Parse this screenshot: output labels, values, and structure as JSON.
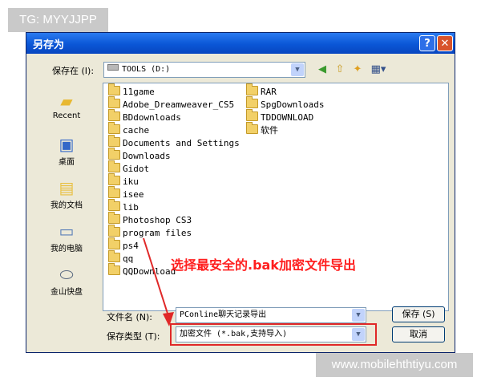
{
  "tag": "TG: MYYJJPP",
  "watermark": "www.mobilehthtiyu.com",
  "dialog": {
    "title": "另存为",
    "help": "?",
    "close": "✕",
    "save_in_label": "保存在 (I):",
    "save_in_value": "TOOLS  (D:)",
    "places": [
      "Recent",
      "桌面",
      "我的文档",
      "我的电脑",
      "金山快盘"
    ],
    "folders_col1": [
      "11game",
      "Adobe_Dreamweaver_CS5",
      "BDdownloads",
      "cache",
      "Documents and Settings",
      "Downloads",
      "Gidot",
      "iku",
      "isee",
      "lib",
      "Photoshop CS3",
      "program files",
      "ps4",
      "qq",
      "QQDownload"
    ],
    "folders_col2": [
      "RAR",
      "SpgDownloads",
      "TDDOWNLOAD",
      "软件"
    ],
    "filename_label": "文件名 (N):",
    "filename_value": "PConline聊天记录导出",
    "filetype_label": "保存类型 (T):",
    "filetype_value": "加密文件 (*.bak,支持导入)",
    "save_button": "保存 (S)",
    "cancel_button": "取消",
    "annotation": "选择最安全的.bak加密文件导出"
  },
  "colors": {
    "titlebar": "#0a56d6",
    "annotation": "#ff1e1e",
    "dialog_bg": "#ece9d8"
  }
}
